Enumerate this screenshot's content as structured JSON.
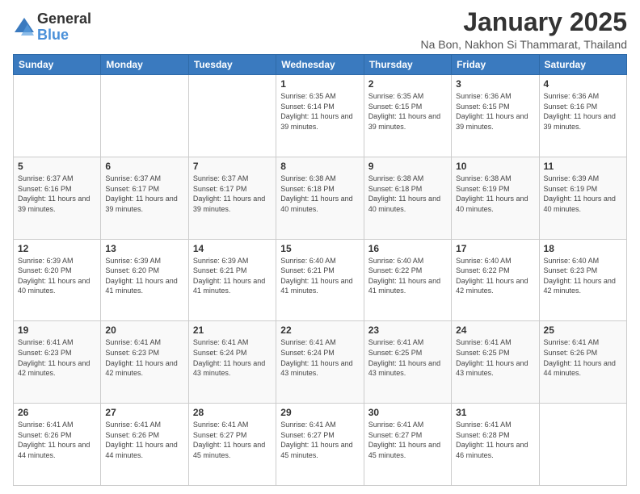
{
  "logo": {
    "general": "General",
    "blue": "Blue"
  },
  "header": {
    "month": "January 2025",
    "location": "Na Bon, Nakhon Si Thammarat, Thailand"
  },
  "days_of_week": [
    "Sunday",
    "Monday",
    "Tuesday",
    "Wednesday",
    "Thursday",
    "Friday",
    "Saturday"
  ],
  "weeks": [
    [
      {
        "day": "",
        "info": ""
      },
      {
        "day": "",
        "info": ""
      },
      {
        "day": "",
        "info": ""
      },
      {
        "day": "1",
        "info": "Sunrise: 6:35 AM\nSunset: 6:14 PM\nDaylight: 11 hours and 39 minutes."
      },
      {
        "day": "2",
        "info": "Sunrise: 6:35 AM\nSunset: 6:15 PM\nDaylight: 11 hours and 39 minutes."
      },
      {
        "day": "3",
        "info": "Sunrise: 6:36 AM\nSunset: 6:15 PM\nDaylight: 11 hours and 39 minutes."
      },
      {
        "day": "4",
        "info": "Sunrise: 6:36 AM\nSunset: 6:16 PM\nDaylight: 11 hours and 39 minutes."
      }
    ],
    [
      {
        "day": "5",
        "info": "Sunrise: 6:37 AM\nSunset: 6:16 PM\nDaylight: 11 hours and 39 minutes."
      },
      {
        "day": "6",
        "info": "Sunrise: 6:37 AM\nSunset: 6:17 PM\nDaylight: 11 hours and 39 minutes."
      },
      {
        "day": "7",
        "info": "Sunrise: 6:37 AM\nSunset: 6:17 PM\nDaylight: 11 hours and 39 minutes."
      },
      {
        "day": "8",
        "info": "Sunrise: 6:38 AM\nSunset: 6:18 PM\nDaylight: 11 hours and 40 minutes."
      },
      {
        "day": "9",
        "info": "Sunrise: 6:38 AM\nSunset: 6:18 PM\nDaylight: 11 hours and 40 minutes."
      },
      {
        "day": "10",
        "info": "Sunrise: 6:38 AM\nSunset: 6:19 PM\nDaylight: 11 hours and 40 minutes."
      },
      {
        "day": "11",
        "info": "Sunrise: 6:39 AM\nSunset: 6:19 PM\nDaylight: 11 hours and 40 minutes."
      }
    ],
    [
      {
        "day": "12",
        "info": "Sunrise: 6:39 AM\nSunset: 6:20 PM\nDaylight: 11 hours and 40 minutes."
      },
      {
        "day": "13",
        "info": "Sunrise: 6:39 AM\nSunset: 6:20 PM\nDaylight: 11 hours and 41 minutes."
      },
      {
        "day": "14",
        "info": "Sunrise: 6:39 AM\nSunset: 6:21 PM\nDaylight: 11 hours and 41 minutes."
      },
      {
        "day": "15",
        "info": "Sunrise: 6:40 AM\nSunset: 6:21 PM\nDaylight: 11 hours and 41 minutes."
      },
      {
        "day": "16",
        "info": "Sunrise: 6:40 AM\nSunset: 6:22 PM\nDaylight: 11 hours and 41 minutes."
      },
      {
        "day": "17",
        "info": "Sunrise: 6:40 AM\nSunset: 6:22 PM\nDaylight: 11 hours and 42 minutes."
      },
      {
        "day": "18",
        "info": "Sunrise: 6:40 AM\nSunset: 6:23 PM\nDaylight: 11 hours and 42 minutes."
      }
    ],
    [
      {
        "day": "19",
        "info": "Sunrise: 6:41 AM\nSunset: 6:23 PM\nDaylight: 11 hours and 42 minutes."
      },
      {
        "day": "20",
        "info": "Sunrise: 6:41 AM\nSunset: 6:23 PM\nDaylight: 11 hours and 42 minutes."
      },
      {
        "day": "21",
        "info": "Sunrise: 6:41 AM\nSunset: 6:24 PM\nDaylight: 11 hours and 43 minutes."
      },
      {
        "day": "22",
        "info": "Sunrise: 6:41 AM\nSunset: 6:24 PM\nDaylight: 11 hours and 43 minutes."
      },
      {
        "day": "23",
        "info": "Sunrise: 6:41 AM\nSunset: 6:25 PM\nDaylight: 11 hours and 43 minutes."
      },
      {
        "day": "24",
        "info": "Sunrise: 6:41 AM\nSunset: 6:25 PM\nDaylight: 11 hours and 43 minutes."
      },
      {
        "day": "25",
        "info": "Sunrise: 6:41 AM\nSunset: 6:26 PM\nDaylight: 11 hours and 44 minutes."
      }
    ],
    [
      {
        "day": "26",
        "info": "Sunrise: 6:41 AM\nSunset: 6:26 PM\nDaylight: 11 hours and 44 minutes."
      },
      {
        "day": "27",
        "info": "Sunrise: 6:41 AM\nSunset: 6:26 PM\nDaylight: 11 hours and 44 minutes."
      },
      {
        "day": "28",
        "info": "Sunrise: 6:41 AM\nSunset: 6:27 PM\nDaylight: 11 hours and 45 minutes."
      },
      {
        "day": "29",
        "info": "Sunrise: 6:41 AM\nSunset: 6:27 PM\nDaylight: 11 hours and 45 minutes."
      },
      {
        "day": "30",
        "info": "Sunrise: 6:41 AM\nSunset: 6:27 PM\nDaylight: 11 hours and 45 minutes."
      },
      {
        "day": "31",
        "info": "Sunrise: 6:41 AM\nSunset: 6:28 PM\nDaylight: 11 hours and 46 minutes."
      },
      {
        "day": "",
        "info": ""
      }
    ]
  ]
}
